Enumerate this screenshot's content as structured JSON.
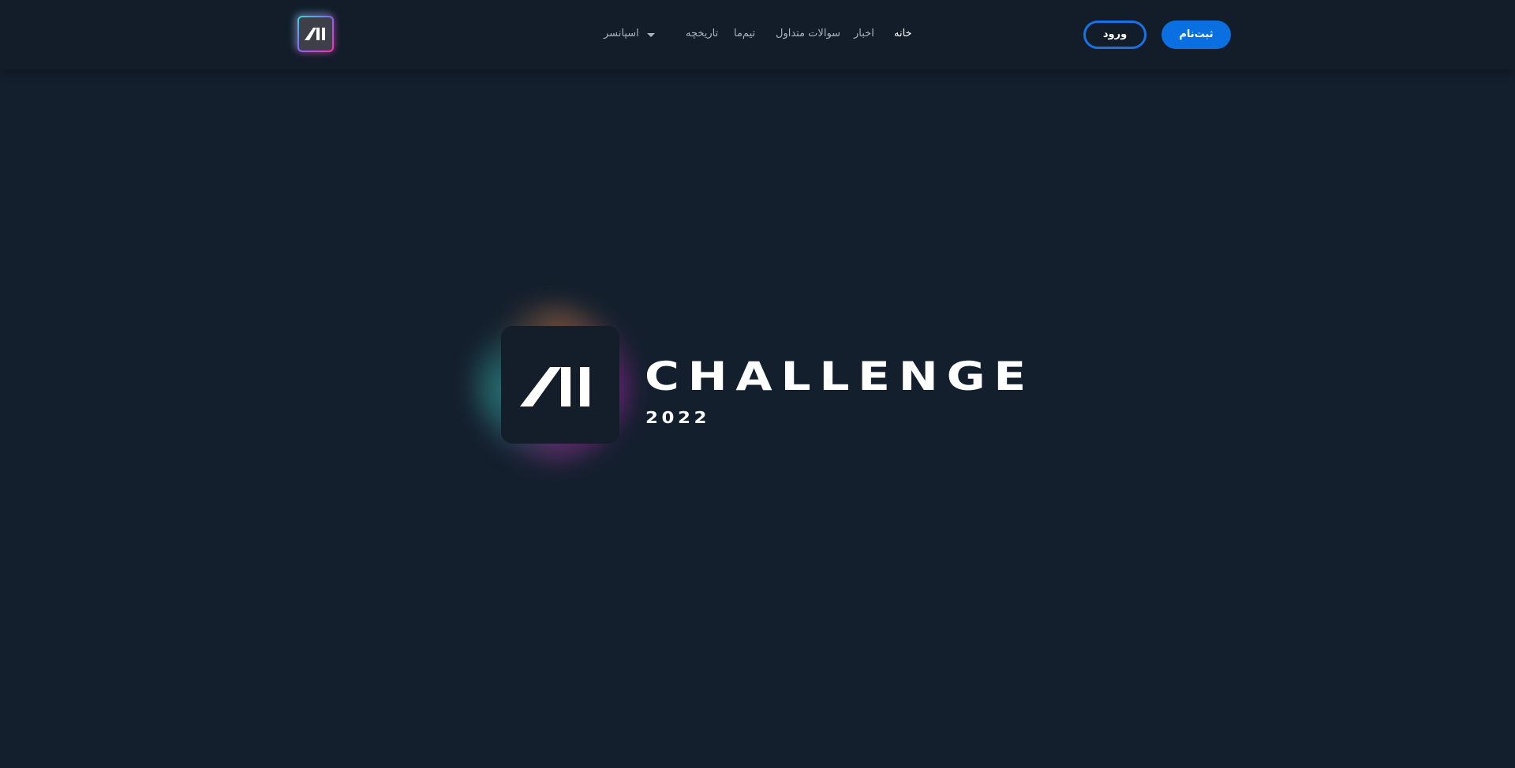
{
  "header": {
    "logo_text": "AI",
    "nav": [
      {
        "label": "خانه",
        "active": true
      },
      {
        "label": "اخبار",
        "active": false
      },
      {
        "label": "سوالات متداول",
        "active": false
      },
      {
        "label": "تیم‌ما",
        "active": false
      },
      {
        "label": "تاریخچه",
        "active": false
      },
      {
        "label": "اسپانسر",
        "active": false,
        "has_dropdown": true
      }
    ],
    "login_label": "ورود",
    "signup_label": "ثبت‌نام"
  },
  "hero": {
    "logo_text": "AI",
    "title": "CHALLENGE",
    "year": "2022"
  },
  "colors": {
    "background": "#141f2d",
    "header": "#131d2a",
    "accent": "#0a6fe0",
    "text": "#ffffff",
    "muted": "#aab3bf"
  }
}
